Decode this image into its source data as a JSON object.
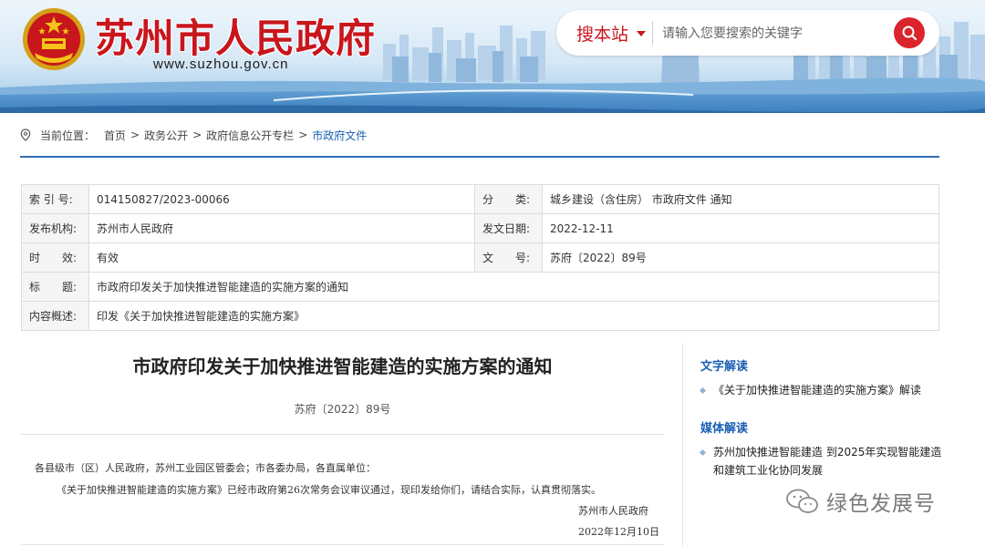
{
  "header": {
    "site_title": "苏州市人民政府",
    "site_url": "www.suzhou.gov.cn",
    "search_scope": "搜本站",
    "search_placeholder": "请输入您要搜索的关键字",
    "brand_color": "#c8161d"
  },
  "breadcrumb": {
    "prefix": "当前位置：",
    "items": [
      "首页",
      "政务公开",
      "政府信息公开专栏",
      "市政府文件"
    ],
    "separator": ">"
  },
  "meta_table": {
    "rows": [
      [
        {
          "label": "索 引 号:",
          "value": "014150827/2023-00066"
        },
        {
          "label": "分　　类:",
          "value": "城乡建设（含住房） 市政府文件 通知"
        }
      ],
      [
        {
          "label": "发布机构:",
          "value": "苏州市人民政府"
        },
        {
          "label": "发文日期:",
          "value": "2022-12-11"
        }
      ],
      [
        {
          "label": "时　　效:",
          "value": "有效"
        },
        {
          "label": "文　　号:",
          "value": "苏府〔2022〕89号"
        }
      ]
    ],
    "title_label": "标　　题:",
    "title_value": "市政府印发关于加快推进智能建造的实施方案的通知",
    "summary_label": "内容概述:",
    "summary_value": "印发《关于加快推进智能建造的实施方案》"
  },
  "article": {
    "title": "市政府印发关于加快推进智能建造的实施方案的通知",
    "doc_number": "苏府〔2022〕89号",
    "addressee": "各县级市（区）人民政府，苏州工业园区管委会；市各委办局，各直属单位：",
    "paragraph": "《关于加快推进智能建造的实施方案》已经市政府第26次常务会议审议通过，现印发给你们，请结合实际，认真贯彻落实。",
    "issuer": "苏州市人民政府",
    "date": "2022年12月10日"
  },
  "side_panel": {
    "text_interp_heading": "文字解读",
    "text_interp_items": [
      "《关于加快推进智能建造的实施方案》解读"
    ],
    "media_interp_heading": "媒体解读",
    "media_interp_items": [
      "苏州加快推进智能建造 到2025年实现智能建造和建筑工业化协同发展"
    ]
  },
  "watermark": {
    "text": "绿色发展号",
    "icon": "wechat-icon"
  }
}
